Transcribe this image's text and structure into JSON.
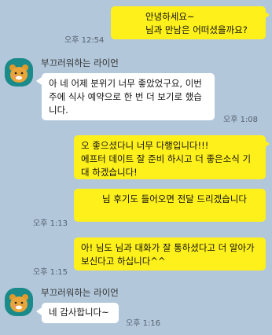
{
  "chat": {
    "contact_name": "부끄러워하는 라이언",
    "messages": [
      {
        "from": "me",
        "text": "안녕하세요~\n님과 만남은 어떠셨을까요?",
        "time": "오후 12:54"
      },
      {
        "from": "other",
        "text": "아 네 어제 분위기 너무 좋았었구요, 이번주에 식사 예약으로 한 번 더 보기로 했습니다.",
        "time": "오후 1:08"
      },
      {
        "from": "me",
        "text": "오 좋으셨다니 너무 다행입니다!!!\n에프터 데이트 잘 준비 하시고 더 좋은소식 기대 하겠습니다!",
        "time": ""
      },
      {
        "from": "me",
        "text": "님 후기도 들어오면 전달 드리겠습니다",
        "time": "오후 1:13"
      },
      {
        "from": "me",
        "text": "아!        님도        님과 대화가 잘 통하셨다고 더 알아가 보신다고 하십니다^^",
        "time": "오후 1:15"
      },
      {
        "from": "other",
        "text": "네 감사합니다~",
        "time": "오후 1:16"
      }
    ]
  },
  "colors": {
    "background": "#b2c7da",
    "my_bubble": "#fef01b",
    "their_bubble": "#ffffff",
    "avatar": "#1b8a8a"
  },
  "icons": {
    "avatar": "ryan-avatar-icon"
  }
}
